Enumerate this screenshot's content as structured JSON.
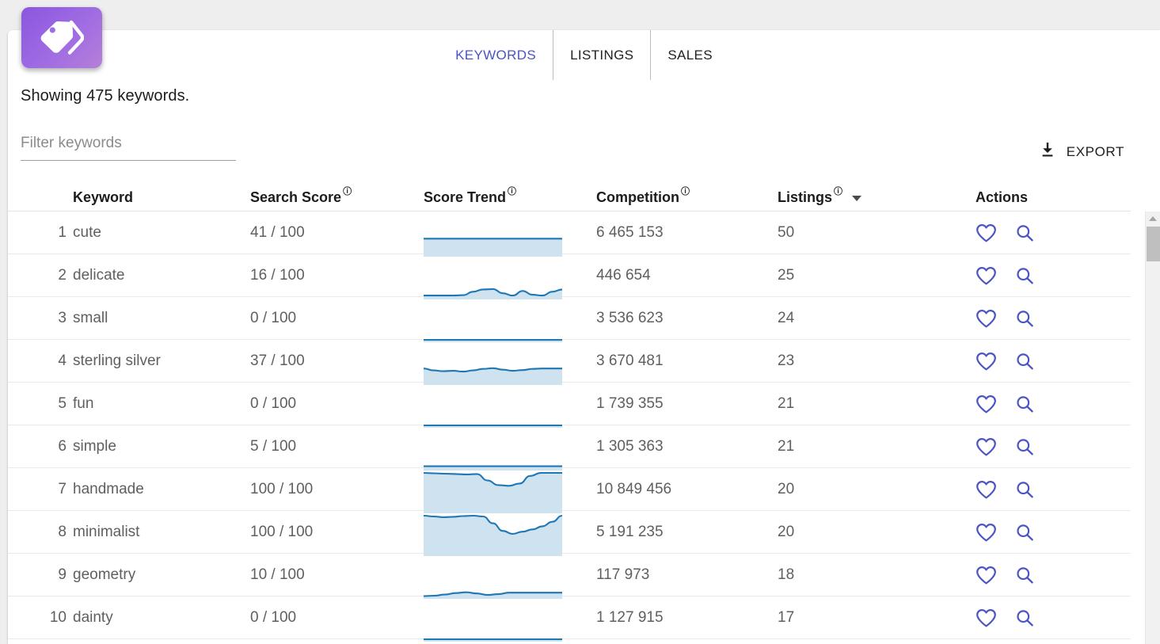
{
  "app": {
    "logo_icon": "price-tag-icon",
    "accent_purple": "#9a62e0",
    "accent_indigo": "#4a54c4",
    "spark_line": "#1f77b4",
    "spark_fill": "#cfe2f0"
  },
  "tabs": [
    {
      "label": "KEYWORDS",
      "active": true
    },
    {
      "label": "LISTINGS",
      "active": false
    },
    {
      "label": "SALES",
      "active": false
    }
  ],
  "summary": {
    "showing_text": "Showing 475 keywords."
  },
  "filter": {
    "placeholder": "Filter keywords",
    "value": ""
  },
  "export": {
    "label": "EXPORT",
    "icon": "download-icon"
  },
  "table": {
    "columns": [
      {
        "key": "index",
        "label": "",
        "info": false,
        "sorted": false
      },
      {
        "key": "keyword",
        "label": "Keyword",
        "info": false,
        "sorted": false
      },
      {
        "key": "search_score",
        "label": "Search Score",
        "info": true,
        "sorted": false
      },
      {
        "key": "score_trend",
        "label": "Score Trend",
        "info": true,
        "sorted": false
      },
      {
        "key": "competition",
        "label": "Competition",
        "info": true,
        "sorted": false
      },
      {
        "key": "listings",
        "label": "Listings",
        "info": true,
        "sorted": true,
        "sort_dir": "desc"
      },
      {
        "key": "actions",
        "label": "Actions",
        "info": false,
        "sorted": false
      }
    ],
    "info_glyph": "ⓘ",
    "row_actions": [
      {
        "name": "favorite-icon",
        "label": "heart"
      },
      {
        "name": "search-icon",
        "label": "magnifier"
      }
    ],
    "rows": [
      {
        "index": "1",
        "keyword": "cute",
        "search_score": "41 / 100",
        "score": 41,
        "competition": "6 465 153",
        "listings": "50"
      },
      {
        "index": "2",
        "keyword": "delicate",
        "search_score": "16 / 100",
        "score": 16,
        "competition": "446 654",
        "listings": "25"
      },
      {
        "index": "3",
        "keyword": "small",
        "search_score": "0 / 100",
        "score": 0,
        "competition": "3 536 623",
        "listings": "24"
      },
      {
        "index": "4",
        "keyword": "sterling silver",
        "search_score": "37 / 100",
        "score": 37,
        "competition": "3 670 481",
        "listings": "23"
      },
      {
        "index": "5",
        "keyword": "fun",
        "search_score": "0 / 100",
        "score": 0,
        "competition": "1 739 355",
        "listings": "21"
      },
      {
        "index": "6",
        "keyword": "simple",
        "search_score": "5 / 100",
        "score": 5,
        "competition": "1 305 363",
        "listings": "21"
      },
      {
        "index": "7",
        "keyword": "handmade",
        "search_score": "100 / 100",
        "score": 100,
        "competition": "10 849 456",
        "listings": "20"
      },
      {
        "index": "8",
        "keyword": "minimalist",
        "search_score": "100 / 100",
        "score": 100,
        "competition": "5 191 235",
        "listings": "20"
      },
      {
        "index": "9",
        "keyword": "geometry",
        "search_score": "10 / 100",
        "score": 10,
        "competition": "117 973",
        "listings": "18"
      },
      {
        "index": "10",
        "keyword": "dainty",
        "search_score": "0 / 100",
        "score": 0,
        "competition": "1 127 915",
        "listings": "17"
      }
    ]
  },
  "chart_data": {
    "type": "area",
    "title": "Score Trend sparklines",
    "ylim": [
      0,
      100
    ],
    "grid": false,
    "legend": "none",
    "xlabel": "",
    "ylabel": "Search Score",
    "series": [
      {
        "name": "cute",
        "values": [
          41,
          41,
          41,
          41,
          41,
          41,
          41,
          41,
          41,
          41,
          41,
          41
        ]
      },
      {
        "name": "delicate",
        "values": [
          4,
          4,
          4,
          4,
          5,
          14,
          20,
          21,
          10,
          4,
          16,
          6,
          4,
          14,
          20
        ]
      },
      {
        "name": "small",
        "values": [
          0,
          0,
          0,
          0,
          0,
          0,
          0,
          0,
          0,
          0,
          0,
          0
        ]
      },
      {
        "name": "sterling silver",
        "values": [
          37,
          32,
          30,
          31,
          29,
          32,
          36,
          38,
          34,
          31,
          33,
          36,
          37,
          37,
          37
        ]
      },
      {
        "name": "fun",
        "values": [
          0,
          0,
          0,
          0,
          0,
          0,
          0,
          0,
          0,
          0,
          0,
          0
        ]
      },
      {
        "name": "simple",
        "values": [
          5,
          5,
          5,
          5,
          5,
          5,
          5,
          5,
          5,
          5,
          5,
          5
        ]
      },
      {
        "name": "handmade",
        "values": [
          100,
          99,
          98,
          97,
          96,
          97,
          80,
          68,
          66,
          72,
          92,
          100,
          100,
          100
        ]
      },
      {
        "name": "minimalist",
        "values": [
          100,
          98,
          96,
          97,
          99,
          100,
          98,
          80,
          60,
          52,
          58,
          64,
          72,
          84,
          100
        ]
      },
      {
        "name": "geometry",
        "values": [
          1,
          2,
          5,
          9,
          11,
          8,
          4,
          6,
          10,
          10,
          10,
          10,
          10,
          10
        ]
      },
      {
        "name": "dainty",
        "values": [
          0,
          0,
          0,
          0,
          0,
          0,
          0,
          0,
          0,
          0,
          0,
          0
        ]
      }
    ]
  },
  "scrollbar": {
    "position": "right",
    "thumb_top_pct": 3,
    "thumb_height_pct": 8
  }
}
